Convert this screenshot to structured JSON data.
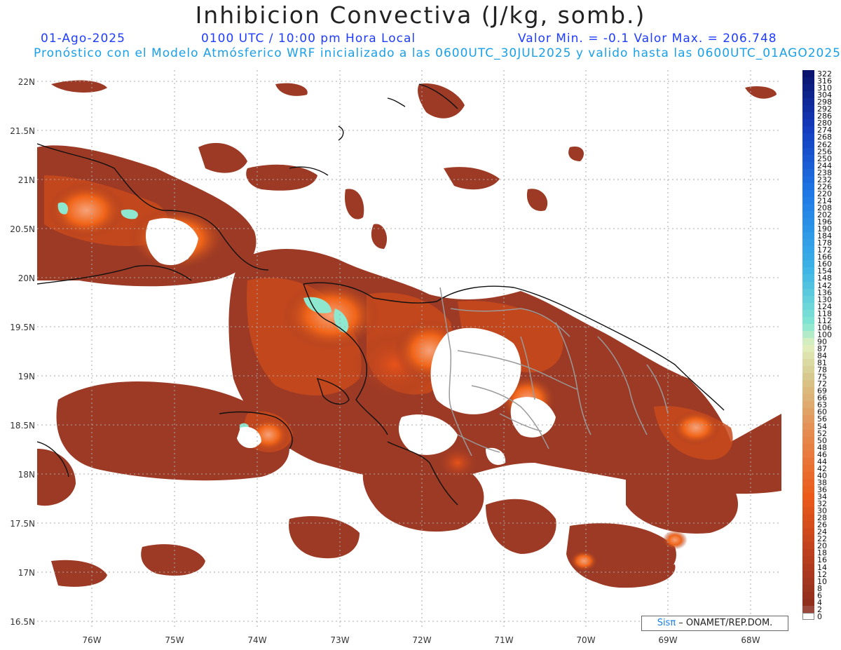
{
  "title": "Inhibicion Convectiva (J/kg, somb.)",
  "header": {
    "date": "01-Ago-2025",
    "time": "0100 UTC / 10:00 pm Hora Local",
    "minmax": "Valor Min. = -0.1  Valor Max. = 206.748",
    "model": "Pronóstico con el Modelo Atmósferico WRF inicializado a las 0600UTC_30JUL2025 y valido hasta las  0600UTC_01AGO2025"
  },
  "axes": {
    "lat_labels": [
      "22N",
      "21.5N",
      "21N",
      "20.5N",
      "20N",
      "19.5N",
      "19N",
      "18.5N",
      "18N",
      "17.5N",
      "17N",
      "16.5N"
    ],
    "lon_labels": [
      "76W",
      "75W",
      "74W",
      "73W",
      "72W",
      "71W",
      "70W",
      "69W",
      "68W"
    ]
  },
  "colorbar": {
    "labels": [
      "322",
      "316",
      "310",
      "304",
      "298",
      "292",
      "286",
      "280",
      "274",
      "268",
      "262",
      "256",
      "250",
      "244",
      "238",
      "232",
      "226",
      "220",
      "214",
      "208",
      "202",
      "196",
      "190",
      "184",
      "178",
      "172",
      "166",
      "160",
      "154",
      "148",
      "142",
      "136",
      "130",
      "124",
      "118",
      "112",
      "106",
      "100",
      "90",
      "87",
      "84",
      "81",
      "78",
      "75",
      "72",
      "69",
      "66",
      "63",
      "60",
      "56",
      "54",
      "52",
      "50",
      "48",
      "46",
      "44",
      "42",
      "40",
      "38",
      "36",
      "34",
      "32",
      "30",
      "28",
      "26",
      "24",
      "22",
      "20",
      "18",
      "16",
      "14",
      "12",
      "10",
      "8",
      "6",
      "4",
      "2",
      "0"
    ]
  },
  "credit": {
    "logo": "Sisπ",
    "text": " – ONAMET/REP.DOM."
  },
  "colors": {
    "base": "#9c3a25",
    "mid": "#c94a1c",
    "hot": "#f05a10",
    "light": "#f4a070",
    "aqua": "#8ee8d0",
    "blue": "#1e4bd8",
    "border": "#999999"
  }
}
